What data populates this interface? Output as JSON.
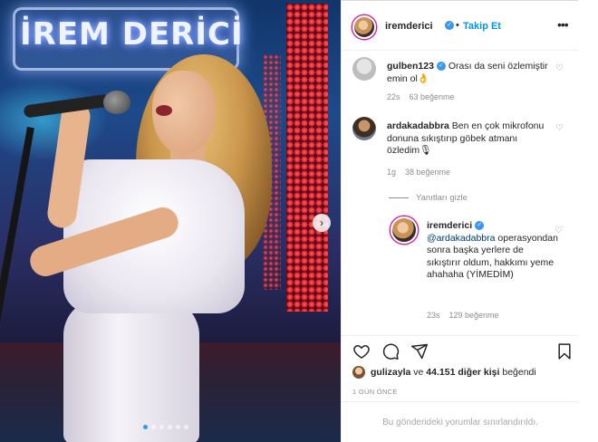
{
  "photo": {
    "sign_text": "İREM DERİCİ",
    "next_arrow": "›",
    "carousel_dots": 6,
    "active_dot": 0
  },
  "header": {
    "username": "iremderici",
    "verified": "✓",
    "separator": "•",
    "follow_label": "Takip Et",
    "more_label": "•••"
  },
  "comments": [
    {
      "username": "gulben123",
      "verified": "✓",
      "text": "Orası da seni özlemiştir emin ol👌",
      "time": "22s",
      "likes": "63 beğenme"
    },
    {
      "username": "ardakadabbra",
      "text": "Ben en çok mikrofonu donuna sıkıştırıp göbek atmanı özledim🎙",
      "time": "1g",
      "likes": "38 beğenme"
    }
  ],
  "hide_replies_label": "Yanıtları gizle",
  "reply": {
    "username": "iremderici",
    "verified": "✓",
    "mention": "@ardakadabbra",
    "text": "operasyondan sonra başka yerlere de sıkıştırır oldum, hakkımı yeme ahahaha (YİMEDİM)",
    "time": "23s",
    "likes": "129 beğenme"
  },
  "likes_summary": {
    "user": "gulizayla",
    "connector": " ve ",
    "others": "44.151 diğer kişi",
    "suffix": " beğendi"
  },
  "time_ago": "1 GÜN ÖNCE",
  "restricted_text": "Bu gönderideki yorumlar sınırlandırıldı.",
  "colors": {
    "link_blue": "#0095f6",
    "verified_blue": "#3897f0",
    "muted_gray": "#8e8e8e"
  }
}
